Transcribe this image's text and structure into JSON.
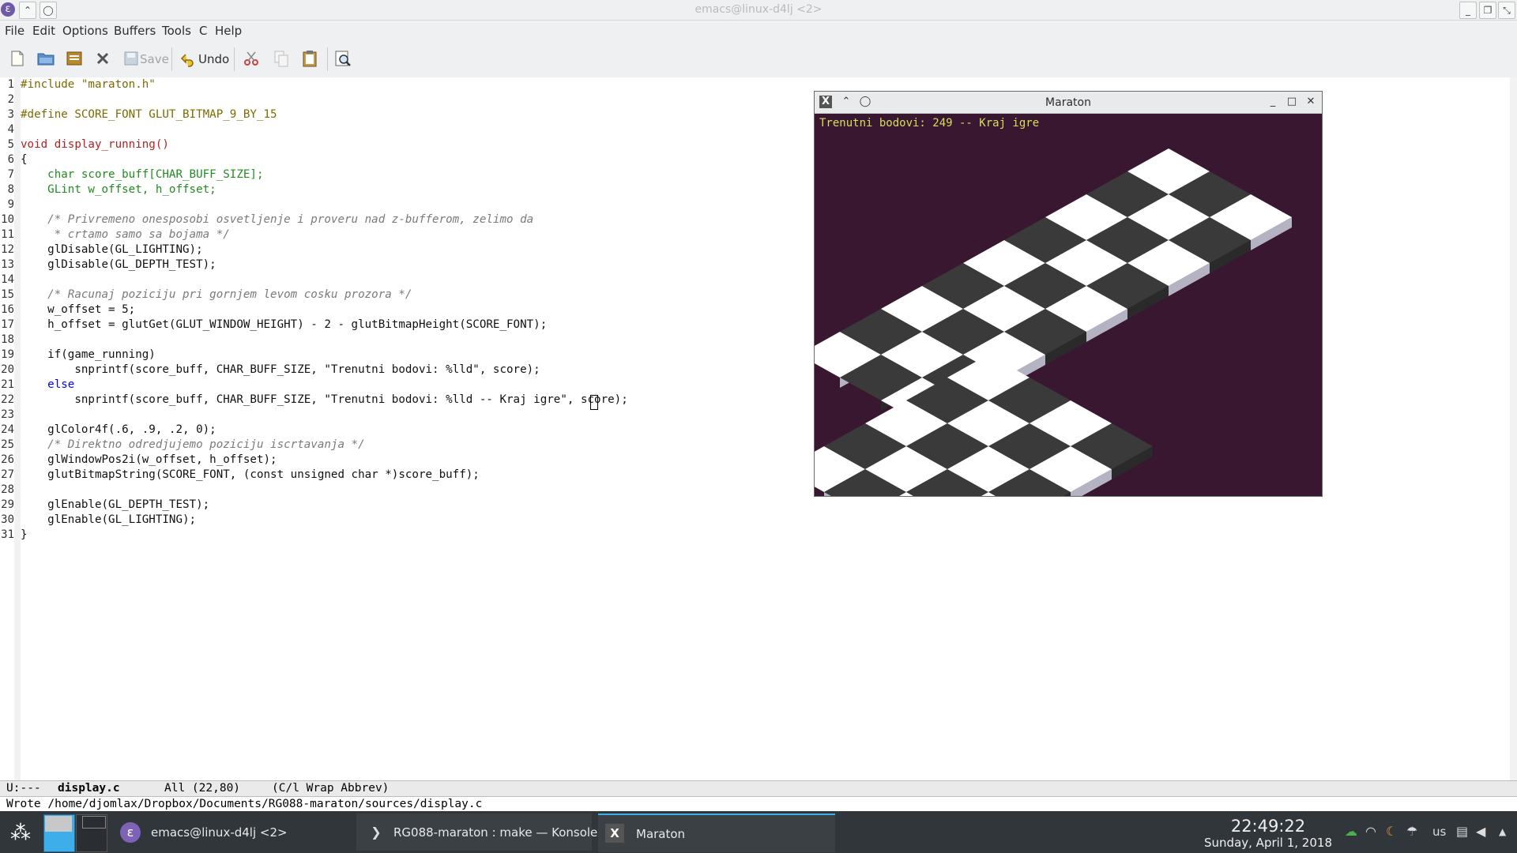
{
  "window": {
    "title": "emacs@linux-d4lj <2>"
  },
  "menubar": {
    "items": [
      "File",
      "Edit",
      "Options",
      "Buffers",
      "Tools",
      "C",
      "Help"
    ]
  },
  "toolbar": {
    "save_label": "Save",
    "undo_label": "Undo"
  },
  "editor": {
    "line_numbers": [
      "1",
      "2",
      "3",
      "4",
      "5",
      "6",
      "7",
      "8",
      "9",
      "10",
      "11",
      "12",
      "13",
      "14",
      "15",
      "16",
      "17",
      "18",
      "19",
      "20",
      "21",
      "22",
      "23",
      "24",
      "25",
      "26",
      "27",
      "28",
      "29",
      "30",
      "31"
    ],
    "lines": [
      "#include \"maraton.h\"",
      "",
      "#define SCORE_FONT GLUT_BITMAP_9_BY_15",
      "",
      "void display_running()",
      "{",
      "    char score_buff[CHAR_BUFF_SIZE];",
      "    GLint w_offset, h_offset;",
      "",
      "    /* Privremeno onesposobi osvetljenje i proveru nad z-bufferom, zelimo da",
      "     * crtamo samo sa bojama */",
      "    glDisable(GL_LIGHTING);",
      "    glDisable(GL_DEPTH_TEST);",
      "",
      "    /* Racunaj poziciju pri gornjem levom cosku prozora */",
      "    w_offset = 5;",
      "    h_offset = glutGet(GLUT_WINDOW_HEIGHT) - 2 - glutBitmapHeight(SCORE_FONT);",
      "",
      "    if(game_running)",
      "        snprintf(score_buff, CHAR_BUFF_SIZE, \"Trenutni bodovi: %lld\", score);",
      "    else",
      "        snprintf(score_buff, CHAR_BUFF_SIZE, \"Trenutni bodovi: %lld -- Kraj igre\", score);",
      "",
      "    glColor4f(.6, .9, .2, 0);",
      "    /* Direktno odredjujemo poziciju iscrtavanja */",
      "    glWindowPos2i(w_offset, h_offset);",
      "    glutBitmapString(SCORE_FONT, (const unsigned char *)score_buff);",
      "",
      "    glEnable(GL_DEPTH_TEST);",
      "    glEnable(GL_LIGHTING);",
      "}"
    ]
  },
  "modeline": {
    "status": "U:---",
    "buffer": "display.c",
    "position": "All (22,80)",
    "modes": "(C/l Wrap Abbrev)"
  },
  "echo": {
    "message": "Wrote /home/djomlax/Dropbox/Documents/RG088-maraton/sources/display.c"
  },
  "maraton": {
    "title": "Maraton",
    "score_text": "Trenutni bodovi: 249 -- Kraj igre"
  },
  "taskbar": {
    "tasks": [
      {
        "label": "emacs@linux-d4lj <2>",
        "icon": "emacs-icon"
      },
      {
        "label": "RG088-maraton : make — Konsole",
        "icon": "terminal-icon"
      },
      {
        "label": "Maraton",
        "icon": "x11-icon"
      }
    ],
    "keyboard_layout": "us",
    "clock_time": "22:49:22",
    "clock_date": "Sunday, April 1, 2018"
  },
  "colors": {
    "accent": "#3daee9",
    "scene_bg": "#3a1730",
    "score_text": "#d4df5a"
  }
}
